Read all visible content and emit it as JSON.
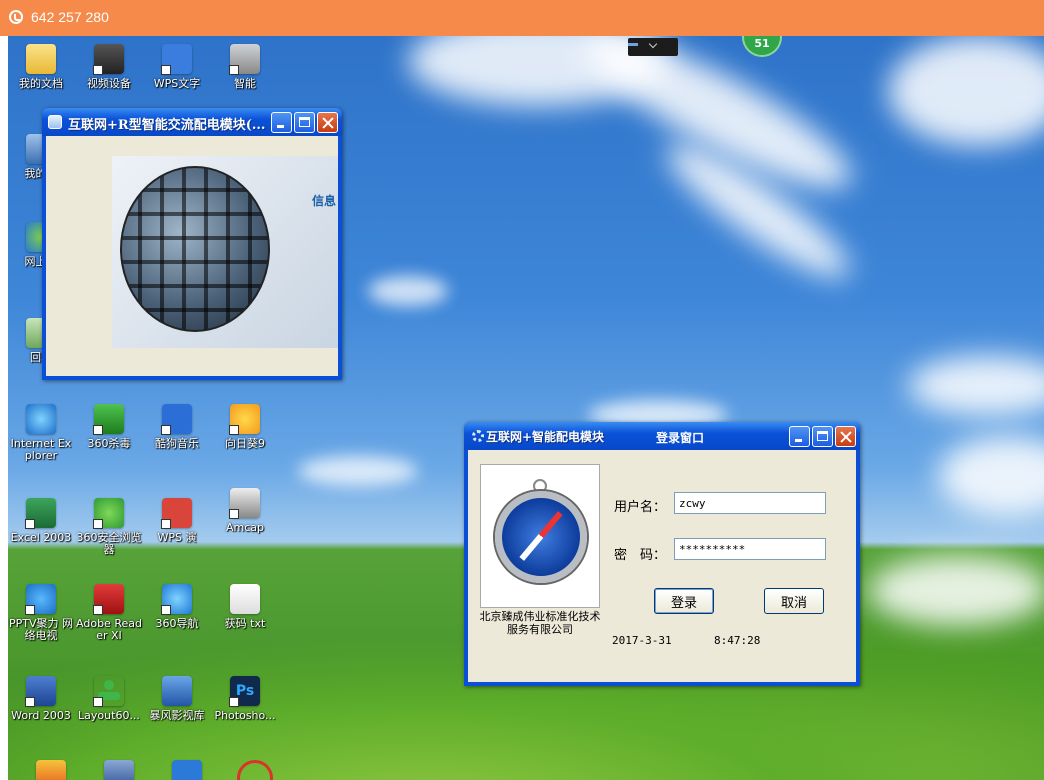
{
  "remote_bar": {
    "id_text": "642 257 280",
    "color": "#f58a4b"
  },
  "overlay_badge": "51",
  "desktop_icons": [
    {
      "label": "我的文档",
      "icon": "folder-icon"
    },
    {
      "label": "视频设备",
      "icon": "camera-icon"
    },
    {
      "label": "WPS文字",
      "icon": "wps-writer-icon"
    },
    {
      "label": "智能",
      "icon": "device-icon"
    },
    {
      "label": "我的电",
      "icon": "my-computer-icon"
    },
    {
      "label": "网上邻",
      "icon": "network-icon"
    },
    {
      "label": "回收",
      "icon": "recycle-bin-icon"
    },
    {
      "label": "Internet Explorer",
      "icon": "ie-icon"
    },
    {
      "label": "360杀毒",
      "icon": "antivirus-icon"
    },
    {
      "label": "酷狗音乐",
      "icon": "music-icon"
    },
    {
      "label": "向日葵9",
      "icon": "sunflower-icon"
    },
    {
      "label": "Excel 2003",
      "icon": "excel-icon"
    },
    {
      "label": "360安全浏览器",
      "icon": "browser-icon"
    },
    {
      "label": "WPS 演",
      "icon": "wps-presentation-icon"
    },
    {
      "label": "Amcap",
      "icon": "amcap-icon"
    },
    {
      "label": "PPTV聚力 网络电视",
      "icon": "pptv-icon"
    },
    {
      "label": "Adobe Reader XI",
      "icon": "pdf-icon"
    },
    {
      "label": "360导航",
      "icon": "navigation-icon"
    },
    {
      "label": "获码 txt",
      "icon": "text-file-icon"
    },
    {
      "label": "Word 2003",
      "icon": "word-icon"
    },
    {
      "label": "Layout60...",
      "icon": "layout-icon"
    },
    {
      "label": "暴风影视库",
      "icon": "video-library-icon"
    },
    {
      "label": "Photosho...",
      "icon": "photoshop-icon"
    }
  ],
  "globe_window": {
    "title": "互联网+R型智能交流配电模块(...",
    "splash_text": "信息"
  },
  "login_window": {
    "title": "互联网+智能配电模块",
    "subtitle": "登录窗口",
    "company": "北京臻成伟业标准化技术服务有限公司",
    "username_label": "用户名：",
    "username_value": "zcwy",
    "password_label": "密　码：",
    "password_value": "**********",
    "login_button": "登录",
    "cancel_button": "取消",
    "date": "2017-3-31",
    "time": "8:47:28"
  }
}
